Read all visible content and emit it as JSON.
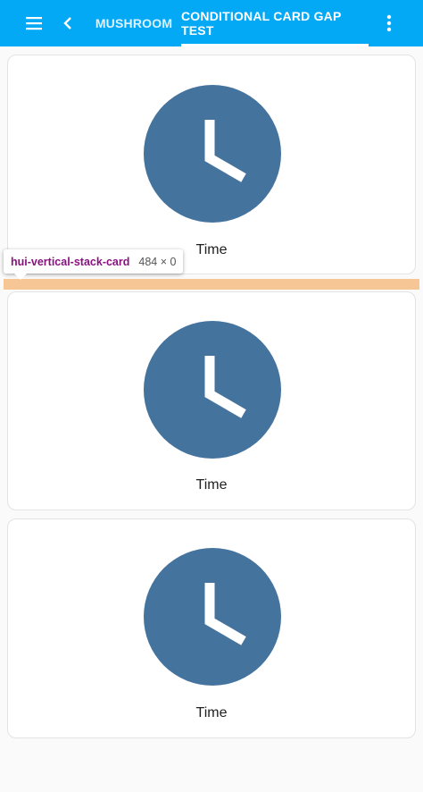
{
  "toolbar": {
    "tabs": [
      {
        "label": "MUSHROOM",
        "active": false
      },
      {
        "label": "CONDITIONAL CARD GAP TEST",
        "active": true
      }
    ],
    "icons": {
      "menu": "hamburger-menu-icon",
      "back": "chevron-left-icon",
      "more": "more-vertical-icon"
    },
    "color": "#03a9f4"
  },
  "cards": [
    {
      "label": "Time",
      "icon": "clock-icon",
      "icon_color": "#44739e"
    },
    {
      "label": "Time",
      "icon": "clock-icon",
      "icon_color": "#44739e"
    },
    {
      "label": "Time",
      "icon": "clock-icon",
      "icon_color": "#44739e"
    }
  ],
  "inspector": {
    "element": "hui-vertical-stack-card",
    "size": "484 × 0",
    "highlight_color": "#f6c48f"
  }
}
